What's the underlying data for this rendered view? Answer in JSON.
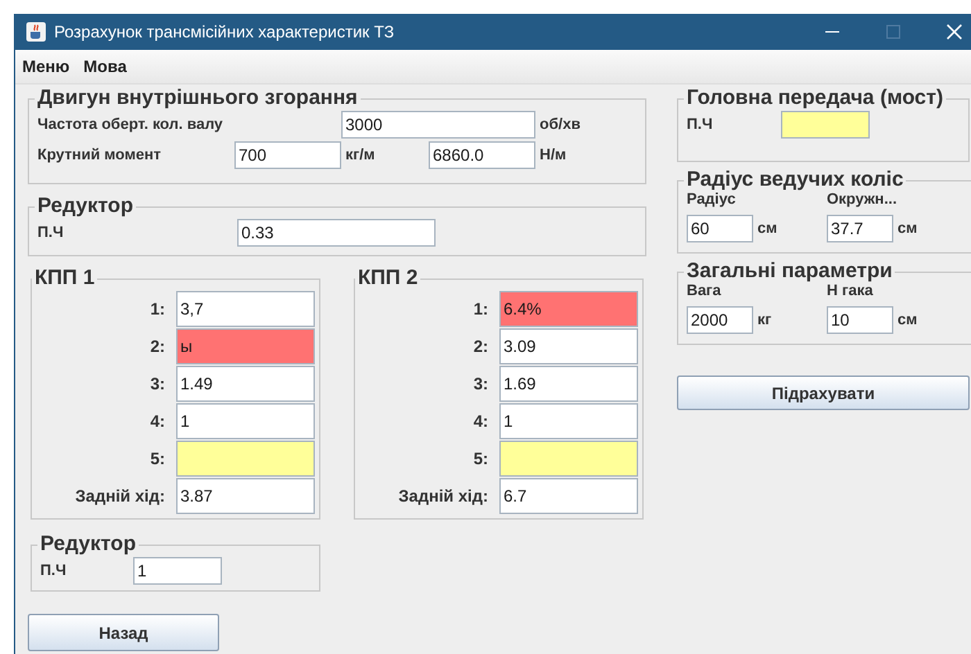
{
  "window": {
    "title": "Розрахунок трансмісійних характеристик ТЗ",
    "maximize_disabled": true
  },
  "menu": [
    "Меню",
    "Мова"
  ],
  "engine": {
    "title": "Двигун внутрішнього згорання",
    "rpm": {
      "label": "Частота оберт. кол. валу",
      "value": "3000",
      "unit": "об/хв",
      "color": "#ffffff"
    },
    "torque": {
      "label": "Крутний момент",
      "values": [
        {
          "value": "700",
          "unit": "кг/м",
          "color": "#ffffff"
        },
        {
          "value": "6860.0",
          "unit": "Н/м",
          "color": "#ffffff"
        }
      ]
    }
  },
  "reducer_top": {
    "title": "Редуктор",
    "label": "П.Ч",
    "value": "0.33",
    "color": "#ffffff"
  },
  "gearboxes": [
    {
      "title": "КПП 1",
      "gears": [
        {
          "label": "1:",
          "value": "3,7",
          "color": "#ffffff"
        },
        {
          "label": "2:",
          "value": "ы",
          "color": "#ff7272"
        },
        {
          "label": "3:",
          "value": "1.49",
          "color": "#ffffff"
        },
        {
          "label": "4:",
          "value": "1",
          "color": "#ffffff"
        },
        {
          "label": "5:",
          "color": "#ffff99"
        },
        {
          "label": "Задній хід:",
          "value": "3.87",
          "color": "#ffffff"
        }
      ]
    },
    {
      "title": "КПП 2",
      "gears": [
        {
          "label": "1:",
          "value": "6.4%",
          "color": "#ff7272"
        },
        {
          "label": "2:",
          "value": "3.09",
          "color": "#ffffff"
        },
        {
          "label": "3:",
          "value": "1.69",
          "color": "#ffffff"
        },
        {
          "label": "4:",
          "value": "1",
          "color": "#ffffff"
        },
        {
          "label": "5:",
          "color": "#ffff99"
        },
        {
          "label": "Задній хід:",
          "value": "6.7",
          "color": "#ffffff"
        }
      ]
    }
  ],
  "reducer_bottom": {
    "title": "Редуктор",
    "label": "П.Ч",
    "value": "1",
    "color": "#ffffff"
  },
  "back_button": "Назад",
  "final_drive": {
    "title": "Головна передача (мост)",
    "label": "П.Ч",
    "color": "#ffff99"
  },
  "wheels": {
    "title": "Радіус ведучих коліс",
    "fields": [
      {
        "label": "Радіус",
        "value": "60",
        "unit": "см",
        "color": "#ffffff"
      },
      {
        "label": "Окружн...",
        "value": "37.7",
        "unit": "см",
        "color": "#ffffff"
      }
    ]
  },
  "general": {
    "title": "Загальні параметри",
    "fields": [
      {
        "label": "Вага",
        "value": "2000",
        "unit": "кг",
        "color": "#ffffff"
      },
      {
        "label": "Н гака",
        "value": "10",
        "unit": "см",
        "color": "#ffffff"
      }
    ]
  },
  "calc_button": "Підрахувати"
}
